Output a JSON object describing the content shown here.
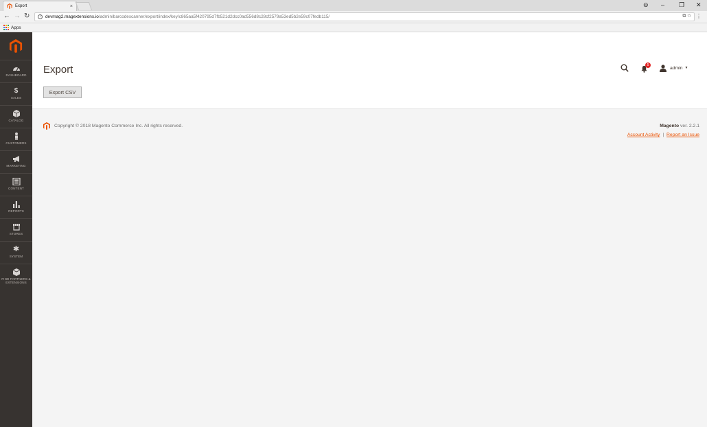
{
  "browser": {
    "tab_title": "Export",
    "tab_close": "×",
    "window_controls": {
      "profile": "⊖",
      "minimize": "–",
      "restore": "❐",
      "close": "✕"
    },
    "url_host": "devmag2.magextensions.io",
    "url_path": "/admin/barcodescanner/export/index/key/c865aa5f420795d7fb521d2dcc0ad556d8c28cf2579a53ed5b2e59c07fedb115/",
    "bookmarks_apps": "Apps"
  },
  "sidebar": {
    "items": [
      {
        "label": "DASHBOARD",
        "icon": "dashboard-icon"
      },
      {
        "label": "SALES",
        "icon": "dollar-icon"
      },
      {
        "label": "CATALOG",
        "icon": "box-icon"
      },
      {
        "label": "CUSTOMERS",
        "icon": "person-icon"
      },
      {
        "label": "MARKETING",
        "icon": "megaphone-icon"
      },
      {
        "label": "CONTENT",
        "icon": "content-icon"
      },
      {
        "label": "REPORTS",
        "icon": "bar-chart-icon"
      },
      {
        "label": "STORES",
        "icon": "store-icon"
      },
      {
        "label": "SYSTEM",
        "icon": "gear-icon"
      },
      {
        "label": "FIND PARTNERS & EXTENSIONS",
        "icon": "partners-icon"
      }
    ]
  },
  "header": {
    "title": "Export",
    "export_button": "Export CSV",
    "notification_count": "5",
    "user_name": "admin"
  },
  "footer": {
    "copyright": "Copyright © 2018 Magento Commerce Inc. All rights reserved.",
    "brand": "Magento",
    "version": " ver. 2.2.1",
    "account_activity": "Account Activity",
    "separator": "|",
    "report_issue": "Report an Issue"
  },
  "colors": {
    "sidebar_bg": "#373330",
    "accent": "#eb5202",
    "badge": "#e22626"
  }
}
